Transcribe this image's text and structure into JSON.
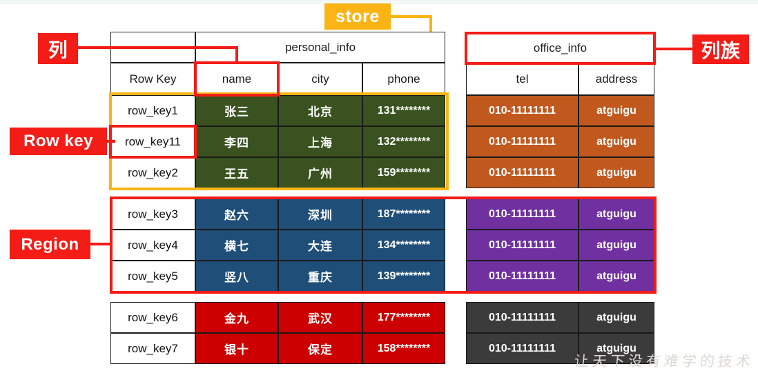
{
  "diagram": {
    "store_tag": "store",
    "watermark": "让天下没有难学的技术"
  },
  "annotations": {
    "column": "列",
    "row_key": "Row key",
    "region": "Region",
    "column_family": "列族"
  },
  "left_table": {
    "family_header": "personal_info",
    "corner_blank": "",
    "columns": [
      "Row Key",
      "name",
      "city",
      "phone"
    ],
    "rows": [
      {
        "row_key": "row_key1",
        "name": "张三",
        "city": "北京",
        "phone": "131********",
        "color": "#3a5220"
      },
      {
        "row_key": "row_key11",
        "name": "李四",
        "city": "上海",
        "phone": "132********",
        "color": "#3a5220"
      },
      {
        "row_key": "row_key2",
        "name": "王五",
        "city": "广州",
        "phone": "159********",
        "color": "#3a5220"
      },
      {
        "row_key": "row_key3",
        "name": "赵六",
        "city": "深圳",
        "phone": "187********",
        "color": "#1f4e79"
      },
      {
        "row_key": "row_key4",
        "name": "横七",
        "city": "大连",
        "phone": "134********",
        "color": "#1f4e79"
      },
      {
        "row_key": "row_key5",
        "name": "竖八",
        "city": "重庆",
        "phone": "139********",
        "color": "#1f4e79"
      },
      {
        "row_key": "row_key6",
        "name": "金九",
        "city": "武汉",
        "phone": "177********",
        "color": "#cc0000"
      },
      {
        "row_key": "row_key7",
        "name": "银十",
        "city": "保定",
        "phone": "158********",
        "color": "#cc0000"
      }
    ]
  },
  "right_table": {
    "family_header": "office_info",
    "columns": [
      "tel",
      "address"
    ],
    "rows": [
      {
        "tel": "010-11111111",
        "address": "atguigu",
        "color": "#c1591f"
      },
      {
        "tel": "010-11111111",
        "address": "atguigu",
        "color": "#c1591f"
      },
      {
        "tel": "010-11111111",
        "address": "atguigu",
        "color": "#c1591f"
      },
      {
        "tel": "010-11111111",
        "address": "atguigu",
        "color": "#7030a0"
      },
      {
        "tel": "010-11111111",
        "address": "atguigu",
        "color": "#7030a0"
      },
      {
        "tel": "010-11111111",
        "address": "atguigu",
        "color": "#7030a0"
      },
      {
        "tel": "010-11111111",
        "address": "atguigu",
        "color": "#3b3b3b"
      },
      {
        "tel": "010-11111111",
        "address": "atguigu",
        "color": "#3b3b3b"
      }
    ]
  },
  "colors": {
    "accent_red": "#f41c16",
    "accent_yellow": "#fcb415",
    "green": "#3a5220",
    "orange": "#c1591f",
    "blue": "#1f4e79",
    "purple": "#7030a0",
    "red": "#cc0000",
    "gray": "#3b3b3b"
  }
}
